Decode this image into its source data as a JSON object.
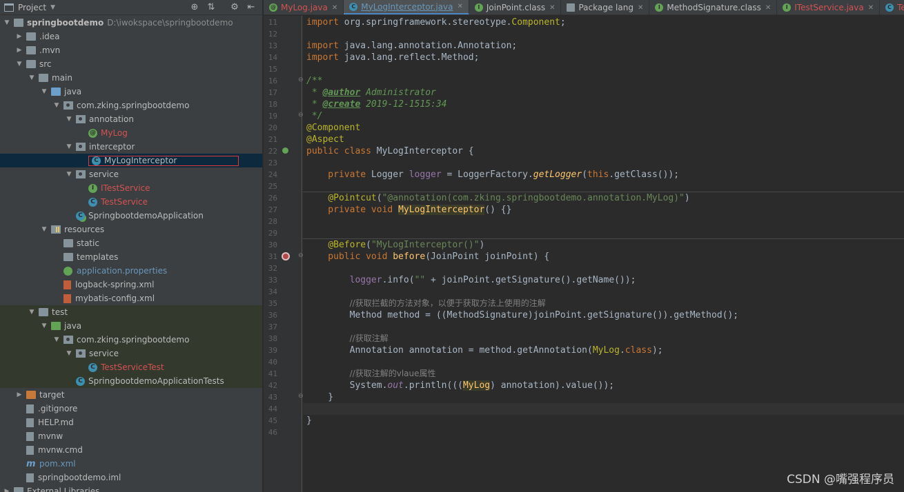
{
  "project": {
    "title": "Project",
    "tree": [
      {
        "label": "springbootdemo",
        "extra": "D:\\iwokspace\\springbootdemo",
        "depth": 0,
        "arrow": "open",
        "icon": "folder",
        "style": "bold"
      },
      {
        "label": ".idea",
        "depth": 1,
        "arrow": "closed",
        "icon": "folder"
      },
      {
        "label": ".mvn",
        "depth": 1,
        "arrow": "closed",
        "icon": "folder"
      },
      {
        "label": "src",
        "depth": 1,
        "arrow": "open",
        "icon": "folder"
      },
      {
        "label": "main",
        "depth": 2,
        "arrow": "open",
        "icon": "folder"
      },
      {
        "label": "java",
        "depth": 3,
        "arrow": "open",
        "icon": "folder-blue"
      },
      {
        "label": "com.zking.springbootdemo",
        "depth": 4,
        "arrow": "open",
        "icon": "pkg"
      },
      {
        "label": "annotation",
        "depth": 5,
        "arrow": "open",
        "icon": "pkg"
      },
      {
        "label": "MyLog",
        "depth": 6,
        "arrow": "none",
        "icon": "circ-a",
        "style": "red"
      },
      {
        "label": "interceptor",
        "depth": 5,
        "arrow": "open",
        "icon": "pkg"
      },
      {
        "label": "MyLogInterceptor",
        "depth": 6,
        "arrow": "none",
        "icon": "circ-c",
        "selected": true
      },
      {
        "label": "service",
        "depth": 5,
        "arrow": "open",
        "icon": "pkg"
      },
      {
        "label": "ITestService",
        "depth": 6,
        "arrow": "none",
        "icon": "circ-i",
        "style": "red"
      },
      {
        "label": "TestService",
        "depth": 6,
        "arrow": "none",
        "icon": "circ-c",
        "style": "red"
      },
      {
        "label": "SpringbootdemoApplication",
        "depth": 5,
        "arrow": "none",
        "icon": "circ-boot"
      },
      {
        "label": "resources",
        "depth": 3,
        "arrow": "open",
        "icon": "res"
      },
      {
        "label": "static",
        "depth": 4,
        "arrow": "none",
        "icon": "folder"
      },
      {
        "label": "templates",
        "depth": 4,
        "arrow": "none",
        "icon": "folder"
      },
      {
        "label": "application.properties",
        "depth": 4,
        "arrow": "none",
        "icon": "file-prop",
        "style": "blue"
      },
      {
        "label": "logback-spring.xml",
        "depth": 4,
        "arrow": "none",
        "icon": "file-xml"
      },
      {
        "label": "mybatis-config.xml",
        "depth": 4,
        "arrow": "none",
        "icon": "file-xml"
      },
      {
        "label": "test",
        "depth": 2,
        "arrow": "open",
        "icon": "folder",
        "testzone": true
      },
      {
        "label": "java",
        "depth": 3,
        "arrow": "open",
        "icon": "folder-green",
        "testzone": true
      },
      {
        "label": "com.zking.springbootdemo",
        "depth": 4,
        "arrow": "open",
        "icon": "pkg",
        "testzone": true
      },
      {
        "label": "service",
        "depth": 5,
        "arrow": "open",
        "icon": "pkg",
        "testzone": true
      },
      {
        "label": "TestServiceTest",
        "depth": 6,
        "arrow": "none",
        "icon": "circ-c",
        "style": "red",
        "testzone": true
      },
      {
        "label": "SpringbootdemoApplicationTests",
        "depth": 5,
        "arrow": "none",
        "icon": "circ-c",
        "testzone": true
      },
      {
        "label": "target",
        "depth": 1,
        "arrow": "closed",
        "icon": "folder-orange"
      },
      {
        "label": ".gitignore",
        "depth": 1,
        "arrow": "none",
        "icon": "file"
      },
      {
        "label": "HELP.md",
        "depth": 1,
        "arrow": "none",
        "icon": "file-md"
      },
      {
        "label": "mvnw",
        "depth": 1,
        "arrow": "none",
        "icon": "file"
      },
      {
        "label": "mvnw.cmd",
        "depth": 1,
        "arrow": "none",
        "icon": "file"
      },
      {
        "label": "pom.xml",
        "depth": 1,
        "arrow": "none",
        "icon": "mvn",
        "style": "blue"
      },
      {
        "label": "springbootdemo.iml",
        "depth": 1,
        "arrow": "none",
        "icon": "file"
      },
      {
        "label": "External Libraries",
        "depth": 0,
        "arrow": "closed",
        "icon": "folder"
      }
    ]
  },
  "tabs": [
    {
      "label": "MyLog.java",
      "icon": "a",
      "style": "red"
    },
    {
      "label": "MyLogInterceptor.java",
      "icon": "c",
      "style": "blue",
      "active": true
    },
    {
      "label": "JoinPoint.class",
      "icon": "i"
    },
    {
      "label": "Package lang",
      "icon": "pkg"
    },
    {
      "label": "MethodSignature.class",
      "icon": "i"
    },
    {
      "label": "ITestService.java",
      "icon": "i",
      "style": "red"
    },
    {
      "label": "TestService.java",
      "icon": "c",
      "style": "red"
    }
  ],
  "editor": {
    "line_numbers": [
      "11",
      "12",
      "13",
      "14",
      "15",
      "16",
      "17",
      "18",
      "19",
      "20",
      "21",
      "22",
      "23",
      "24",
      "25",
      "26",
      "27",
      "28",
      "29",
      "30",
      "31",
      "32",
      "33",
      "34",
      "35",
      "36",
      "37",
      "38",
      "39",
      "40",
      "41",
      "42",
      "43",
      "44",
      "45",
      "46"
    ],
    "code": {
      "l11": [
        "import",
        " org.springframework.stereotype.",
        "Component",
        ";"
      ],
      "l13": [
        "import",
        " java.lang.annotation.Annotation;"
      ],
      "l14": [
        "import",
        " java.lang.reflect.Method;"
      ],
      "l16": "/**",
      "l17": [
        " * ",
        "@author",
        " Administrator"
      ],
      "l18": [
        " * ",
        "@create",
        " 2019-12-1515:34"
      ],
      "l19": " */",
      "l20": "@Component",
      "l21": "@Aspect",
      "l22": [
        "public class",
        " MyLogInterceptor {"
      ],
      "l24": [
        "    private",
        " Logger ",
        "logger",
        " = LoggerFactory.",
        "getLogger",
        "(",
        "this",
        ".getClass());"
      ],
      "l26": [
        "    ",
        "@Pointcut",
        "(",
        "\"@annotation(com.zking.springbootdemo.annotation.MyLog)\"",
        ")"
      ],
      "l27": [
        "    private void",
        " ",
        "MyLogInterceptor",
        "() {}"
      ],
      "l30": [
        "    ",
        "@Before",
        "(",
        "\"MyLogInterceptor()\"",
        ")"
      ],
      "l31": [
        "    public void",
        " ",
        "before",
        "(JoinPoint joinPoint) {"
      ],
      "l33": [
        "        ",
        "logger",
        ".info(",
        "\"\"",
        " + joinPoint.getSignature().getName());"
      ],
      "l35": [
        "        ",
        "//获取拦截的方法对象，以便于获取方法上使用的注解"
      ],
      "l36": [
        "        Method method = ((MethodSignature)joinPoint.getSignature()).getMethod();"
      ],
      "l38": [
        "        ",
        "//获取注解"
      ],
      "l39": [
        "        Annotation annotation = method.getAnnotation(",
        "MyLog",
        ".",
        "class",
        ");"
      ],
      "l41": [
        "        ",
        "//获取注解的vlaue属性"
      ],
      "l42": [
        "        System.",
        "out",
        ".println(((",
        "MyLog",
        ") annotation).value());"
      ],
      "l43": "    }",
      "l45": "}"
    }
  },
  "watermark": "CSDN @嘴强程序员",
  "colors": {
    "keyword": "#cc7832",
    "annotation": "#bbb529",
    "string": "#6a8759",
    "comment": "#808080",
    "field": "#9876aa",
    "method": "#ffc66d",
    "selection": "#4a88c7"
  }
}
